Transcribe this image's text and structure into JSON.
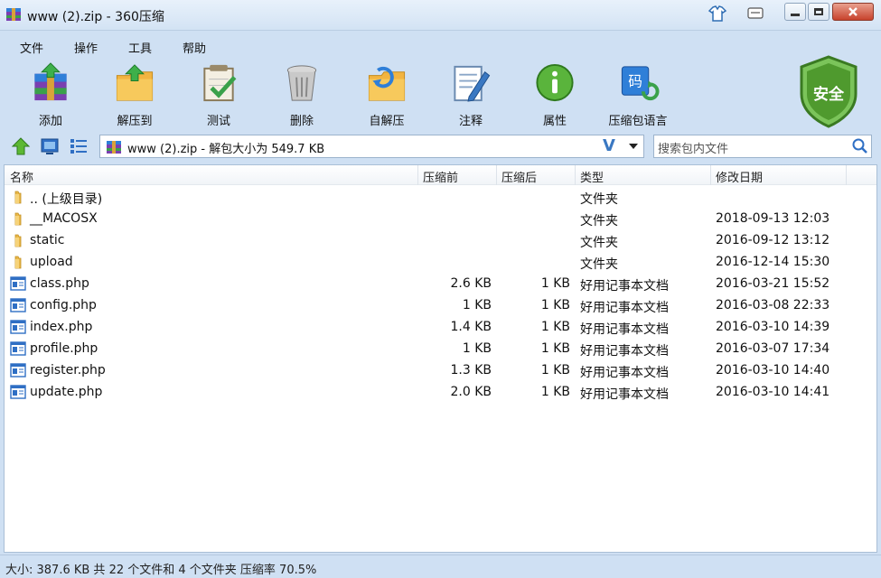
{
  "window": {
    "title": "www (2).zip - 360压缩"
  },
  "menu": [
    "文件",
    "操作",
    "工具",
    "帮助"
  ],
  "toolbar": [
    {
      "label": "添加",
      "icon": "add-archive-icon"
    },
    {
      "label": "解压到",
      "icon": "extract-to-icon"
    },
    {
      "label": "测试",
      "icon": "test-icon"
    },
    {
      "label": "删除",
      "icon": "delete-icon"
    },
    {
      "label": "自解压",
      "icon": "self-extract-icon"
    },
    {
      "label": "注释",
      "icon": "comment-icon"
    },
    {
      "label": "属性",
      "icon": "info-icon"
    },
    {
      "label": "压缩包语言",
      "icon": "archive-language-icon"
    }
  ],
  "shield": {
    "label": "安全",
    "color": "#4f9a2e"
  },
  "path": {
    "text": "www (2).zip - 解包大小为 549.7 KB"
  },
  "search": {
    "placeholder": "搜索包内文件"
  },
  "columns": [
    "名称",
    "压缩前",
    "压缩后",
    "类型",
    "修改日期"
  ],
  "files": [
    {
      "name": ".. (上级目录)",
      "size": "",
      "packed": "",
      "type": "文件夹",
      "date": "",
      "kind": "folder"
    },
    {
      "name": "__MACOSX",
      "size": "",
      "packed": "",
      "type": "文件夹",
      "date": "2018-09-13 12:03",
      "kind": "folder"
    },
    {
      "name": "static",
      "size": "",
      "packed": "",
      "type": "文件夹",
      "date": "2016-09-12 13:12",
      "kind": "folder"
    },
    {
      "name": "upload",
      "size": "",
      "packed": "",
      "type": "文件夹",
      "date": "2016-12-14 15:30",
      "kind": "folder"
    },
    {
      "name": "class.php",
      "size": "2.6 KB",
      "packed": "1 KB",
      "type": "好用记事本文档",
      "date": "2016-03-21 15:52",
      "kind": "file"
    },
    {
      "name": "config.php",
      "size": "1 KB",
      "packed": "1 KB",
      "type": "好用记事本文档",
      "date": "2016-03-08 22:33",
      "kind": "file"
    },
    {
      "name": "index.php",
      "size": "1.4 KB",
      "packed": "1 KB",
      "type": "好用记事本文档",
      "date": "2016-03-10 14:39",
      "kind": "file"
    },
    {
      "name": "profile.php",
      "size": "1 KB",
      "packed": "1 KB",
      "type": "好用记事本文档",
      "date": "2016-03-07 17:34",
      "kind": "file"
    },
    {
      "name": "register.php",
      "size": "1.3 KB",
      "packed": "1 KB",
      "type": "好用记事本文档",
      "date": "2016-03-10 14:40",
      "kind": "file"
    },
    {
      "name": "update.php",
      "size": "2.0 KB",
      "packed": "1 KB",
      "type": "好用记事本文档",
      "date": "2016-03-10 14:41",
      "kind": "file"
    }
  ],
  "status": {
    "text": "大小: 387.6 KB 共 22 个文件和 4 个文件夹 压缩率 70.5%"
  }
}
